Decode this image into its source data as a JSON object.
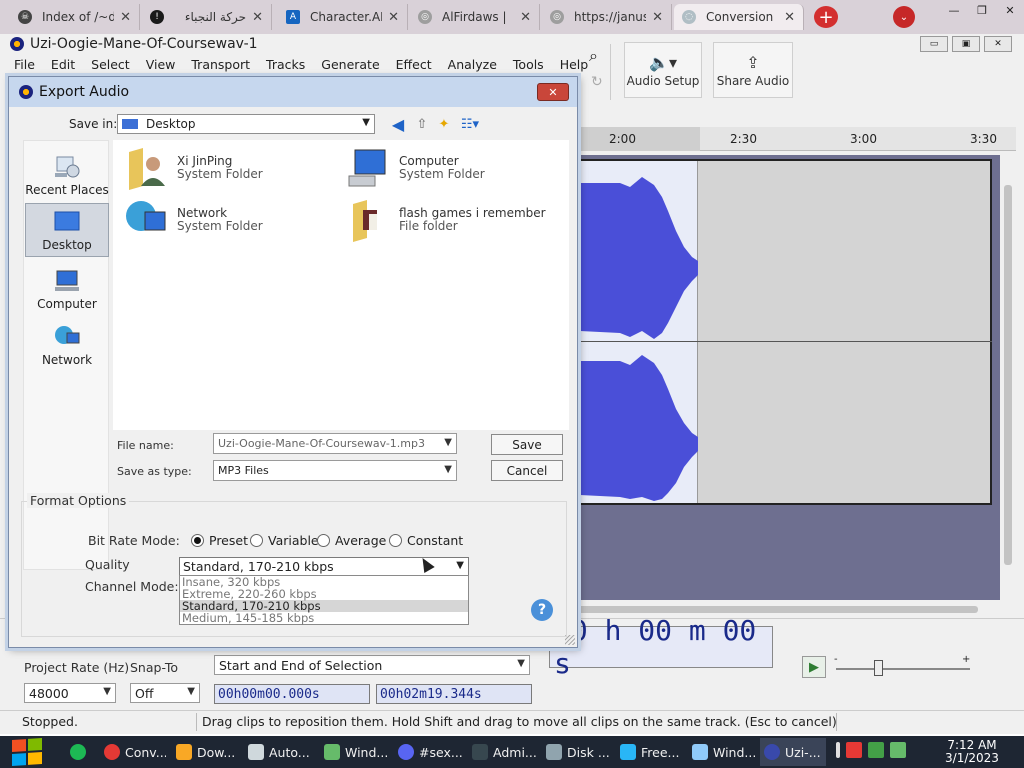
{
  "browser": {
    "tabs": [
      {
        "title": "Index of /~d",
        "fav_color": "#444444",
        "fav_glyph": "☠"
      },
      {
        "title": "حركة النجباء",
        "fav_color": "#1a1a1a",
        "fav_glyph": "!"
      },
      {
        "title": "Character.AI",
        "fav_color": "#1565c0",
        "fav_glyph": "A"
      },
      {
        "title": "AlFirdaws |",
        "fav_color": "#9e9e9e",
        "fav_glyph": "◎"
      },
      {
        "title": "https://janus",
        "fav_color": "#9e9e9e",
        "fav_glyph": "◎"
      },
      {
        "title": "Conversion",
        "fav_color": "#b0bec5",
        "fav_glyph": "◌"
      }
    ],
    "close_glyph": "✕",
    "new_tab_glyph": "+",
    "tab_menu_glyph": "⌄",
    "window_controls": [
      "—",
      "❐",
      "✕"
    ]
  },
  "app": {
    "title": "Uzi-Oogie-Mane-Of-Coursewav-1",
    "controls": [
      "▭",
      "▣",
      "✕"
    ],
    "menu": [
      "File",
      "Edit",
      "Select",
      "View",
      "Transport",
      "Tracks",
      "Generate",
      "Effect",
      "Analyze",
      "Tools",
      "Help"
    ],
    "toolbar": {
      "audio_setup": "Audio Setup",
      "share_audio": "Share Audio",
      "search_icon": "⌕",
      "redo_icon": "↻",
      "speaker_icon": "🔈▾",
      "share_icon": "⇪"
    },
    "timeline_ticks": [
      "2:00",
      "2:30",
      "3:00",
      "3:30"
    ],
    "waveform_color": "#4a4fd8",
    "bottom": {
      "project_rate_label": "Project Rate (Hz)",
      "project_rate": "48000",
      "snap_to_label": "Snap-To",
      "snap_to": "Off",
      "selection_mode": "Start and End of Selection",
      "start_time": "00h00m00.000s",
      "end_time": "00h02m19.344s",
      "big_time": "00 h 00 m 00 s",
      "play_glyph": "▶",
      "slider_min": "-",
      "slider_max": "+"
    },
    "status": {
      "state": "Stopped.",
      "hint": "Drag clips to reposition them. Hold Shift and drag to move all clips on the same track. (Esc to cancel)"
    }
  },
  "dialog": {
    "title": "Export Audio",
    "close_glyph": "✕",
    "save_in_label": "Save in:",
    "save_in_value": "Desktop",
    "nav_icons": [
      "back-icon",
      "up-folder-icon",
      "new-folder-icon",
      "view-menu-icon"
    ],
    "places": [
      "Recent Places",
      "Desktop",
      "Computer",
      "Network"
    ],
    "files": [
      {
        "name": "Xi JinPing",
        "type": "System Folder"
      },
      {
        "name": "Computer",
        "type": "System Folder"
      },
      {
        "name": "Network",
        "type": "System Folder"
      },
      {
        "name": "flash games i remember",
        "type": "File folder"
      }
    ],
    "file_name_label": "File name:",
    "file_name": "Uzi-Oogie-Mane-Of-Coursewav-1.mp3",
    "save_type_label": "Save as type:",
    "save_type": "MP3 Files",
    "save_button": "Save",
    "cancel_button": "Cancel",
    "format_options_label": "Format Options",
    "bit_rate_mode_label": "Bit Rate Mode:",
    "bit_rate_modes": [
      "Preset",
      "Variable",
      "Average",
      "Constant"
    ],
    "selected_mode": "Preset",
    "quality_label": "Quality",
    "quality_value": "Standard, 170-210 kbps",
    "quality_options": [
      "Insane, 320 kbps",
      "Extreme, 220-260 kbps",
      "Standard, 170-210 kbps",
      "Medium, 145-185 kbps"
    ],
    "channel_mode_label": "Channel Mode:",
    "help_glyph": "?"
  },
  "taskbar": {
    "items": [
      {
        "label": "",
        "color": "#1db954"
      },
      {
        "label": "Conv...",
        "color": "#e53935"
      },
      {
        "label": "Dow...",
        "color": "#f9a825"
      },
      {
        "label": "Auto...",
        "color": "#cfd8dc"
      },
      {
        "label": "Wind...",
        "color": "#66bb6a"
      },
      {
        "label": "#sex...",
        "color": "#5865f2"
      },
      {
        "label": "Admi...",
        "color": "#37474f"
      },
      {
        "label": "Disk ...",
        "color": "#90a4ae"
      },
      {
        "label": "Free...",
        "color": "#29b6f6"
      },
      {
        "label": "Wind...",
        "color": "#90caf9"
      },
      {
        "label": "Uzi-...",
        "color": "#3949ab"
      }
    ],
    "time": "7:12 AM",
    "date": "3/1/2023",
    "tray_colors": [
      "#e53935",
      "#43a047",
      "#66bb6a"
    ]
  }
}
